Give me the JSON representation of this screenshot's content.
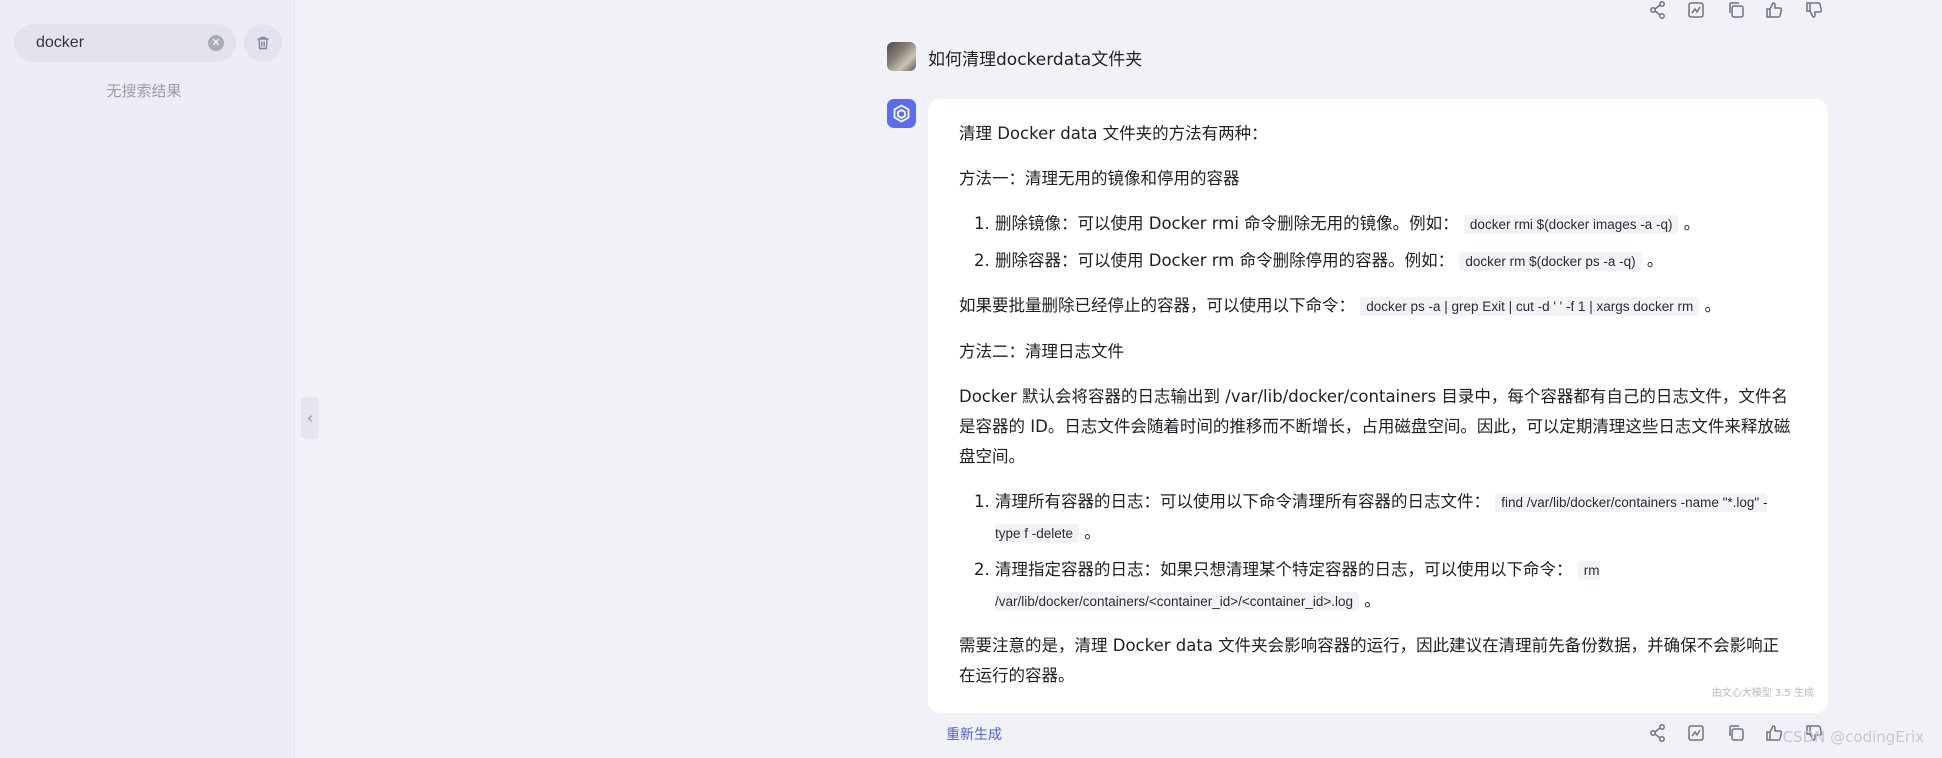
{
  "sidebar": {
    "search": {
      "value": "docker",
      "placeholder": ""
    },
    "no_result": "无搜索结果"
  },
  "conversation": {
    "question": "如何清理dockerdata文件夹",
    "answer": {
      "intro": "清理 Docker data 文件夹的方法有两种：",
      "method1_title": "方法一：清理无用的镜像和停用的容器",
      "method1_items": [
        {
          "text": "删除镜像：可以使用 Docker rmi 命令删除无用的镜像。例如：",
          "code": "docker rmi $(docker images -a -q)",
          "tail": " 。"
        },
        {
          "text": "删除容器：可以使用 Docker rm 命令删除停用的容器。例如：",
          "code": "docker rm $(docker ps -a -q)",
          "tail": " 。"
        }
      ],
      "batch_text": "如果要批量删除已经停止的容器，可以使用以下命令：",
      "batch_code": "docker ps -a | grep Exit | cut -d ' ' -f 1 | xargs docker rm",
      "batch_tail": " 。",
      "method2_title": "方法二：清理日志文件",
      "method2_desc": "Docker 默认会将容器的日志输出到 /var/lib/docker/containers 目录中，每个容器都有自己的日志文件，文件名是容器的 ID。日志文件会随着时间的推移而不断增长，占用磁盘空间。因此，可以定期清理这些日志文件来释放磁盘空间。",
      "method2_items": [
        {
          "text": "清理所有容器的日志：可以使用以下命令清理所有容器的日志文件：",
          "code": "find /var/lib/docker/containers -name \"*.log\" -type f -delete",
          "tail": " 。"
        },
        {
          "text": "清理指定容器的日志：如果只想清理某个特定容器的日志，可以使用以下命令：",
          "code": "rm /var/lib/docker/containers/<container_id>/<container_id>.log",
          "tail": " 。"
        }
      ],
      "note": "需要注意的是，清理 Docker data 文件夹会影响容器的运行，因此建议在清理前先备份数据，并确保不会影响正在运行的容器。",
      "gen_note": "由文心大模型 3.5 生成"
    },
    "regenerate_label": "重新生成"
  },
  "action_icons": [
    "share-icon",
    "chart-icon",
    "copy-icon",
    "thumbs-up-icon",
    "thumbs-down-icon"
  ],
  "watermark": "CSDN @codingErix",
  "colors": {
    "accent": "#4c62e6",
    "background": "#f1f2f8",
    "card": "#ffffff"
  }
}
